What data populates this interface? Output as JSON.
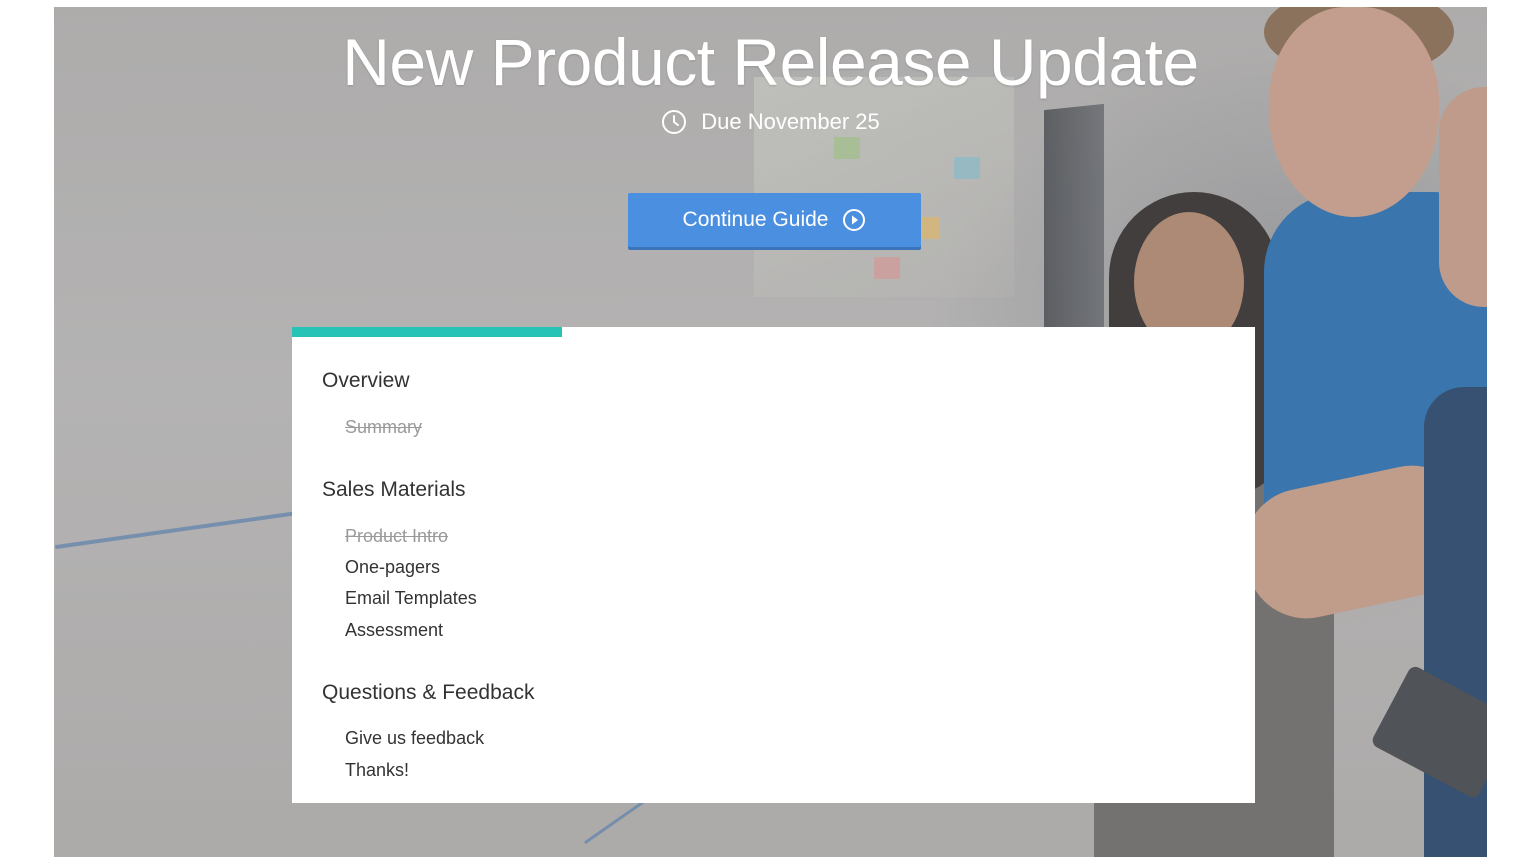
{
  "hero": {
    "title": "New Product Release Update",
    "due_text": "Due November 25",
    "continue_label": "Continue Guide"
  },
  "progress": {
    "fraction_complete": 0.28,
    "color": "#27c3b6"
  },
  "colors": {
    "button": "#4a8fe0",
    "heading_text": "#333333",
    "completed_text": "#9a9a9a"
  },
  "outline": {
    "sections": [
      {
        "heading": "Overview",
        "items": [
          {
            "label": "Summary",
            "completed": true
          }
        ]
      },
      {
        "heading": "Sales Materials",
        "items": [
          {
            "label": "Product Intro",
            "completed": true
          },
          {
            "label": "One-pagers",
            "completed": false
          },
          {
            "label": "Email Templates",
            "completed": false
          },
          {
            "label": "Assessment",
            "completed": false
          }
        ]
      },
      {
        "heading": "Questions & Feedback",
        "items": [
          {
            "label": "Give us feedback",
            "completed": false
          },
          {
            "label": "Thanks!",
            "completed": false
          }
        ]
      }
    ]
  },
  "icons": {
    "due": "clock-icon",
    "continue": "play-circle-icon"
  }
}
